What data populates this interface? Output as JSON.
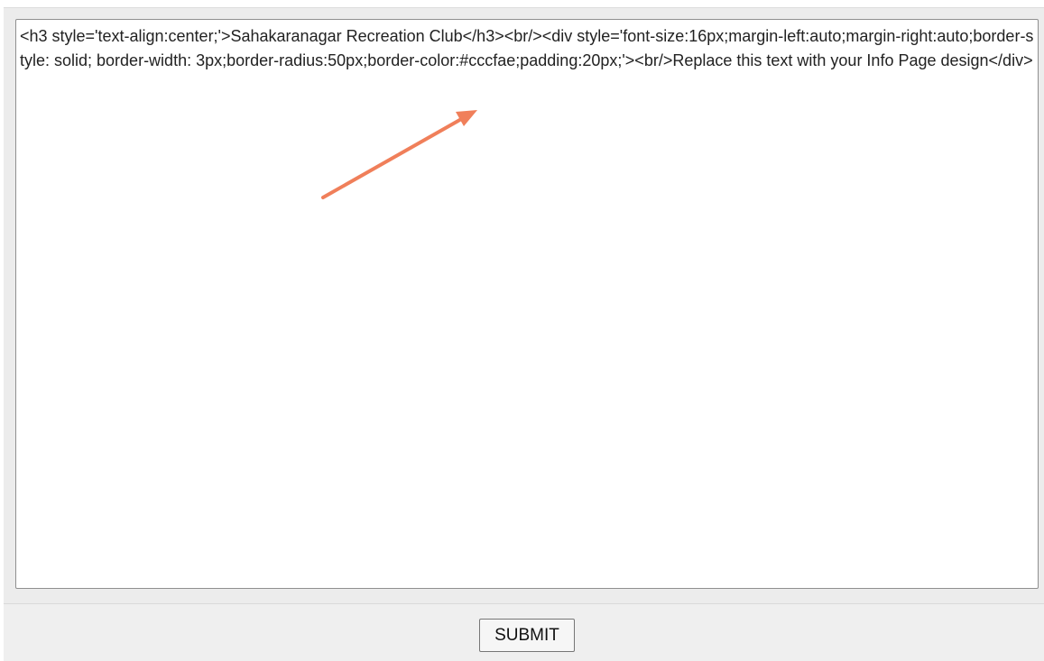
{
  "editor": {
    "content": "<h3 style='text-align:center;'>Sahakaranagar Recreation Club</h3><br/><div style='font-size:16px;margin-left:auto;margin-right:auto;border-style: solid; border-width: 3px;border-radius:50px;border-color:#cccfae;padding:20px;'><br/>Replace this text with your Info Page design</div>"
  },
  "footer": {
    "submit_label": "SUBMIT"
  },
  "annotation": {
    "arrow_color": "#f07f5a",
    "arrow_icon": "annotation-arrow-icon"
  },
  "colors": {
    "panel_background": "#ececec",
    "editor_border": "#8f8f8f"
  }
}
